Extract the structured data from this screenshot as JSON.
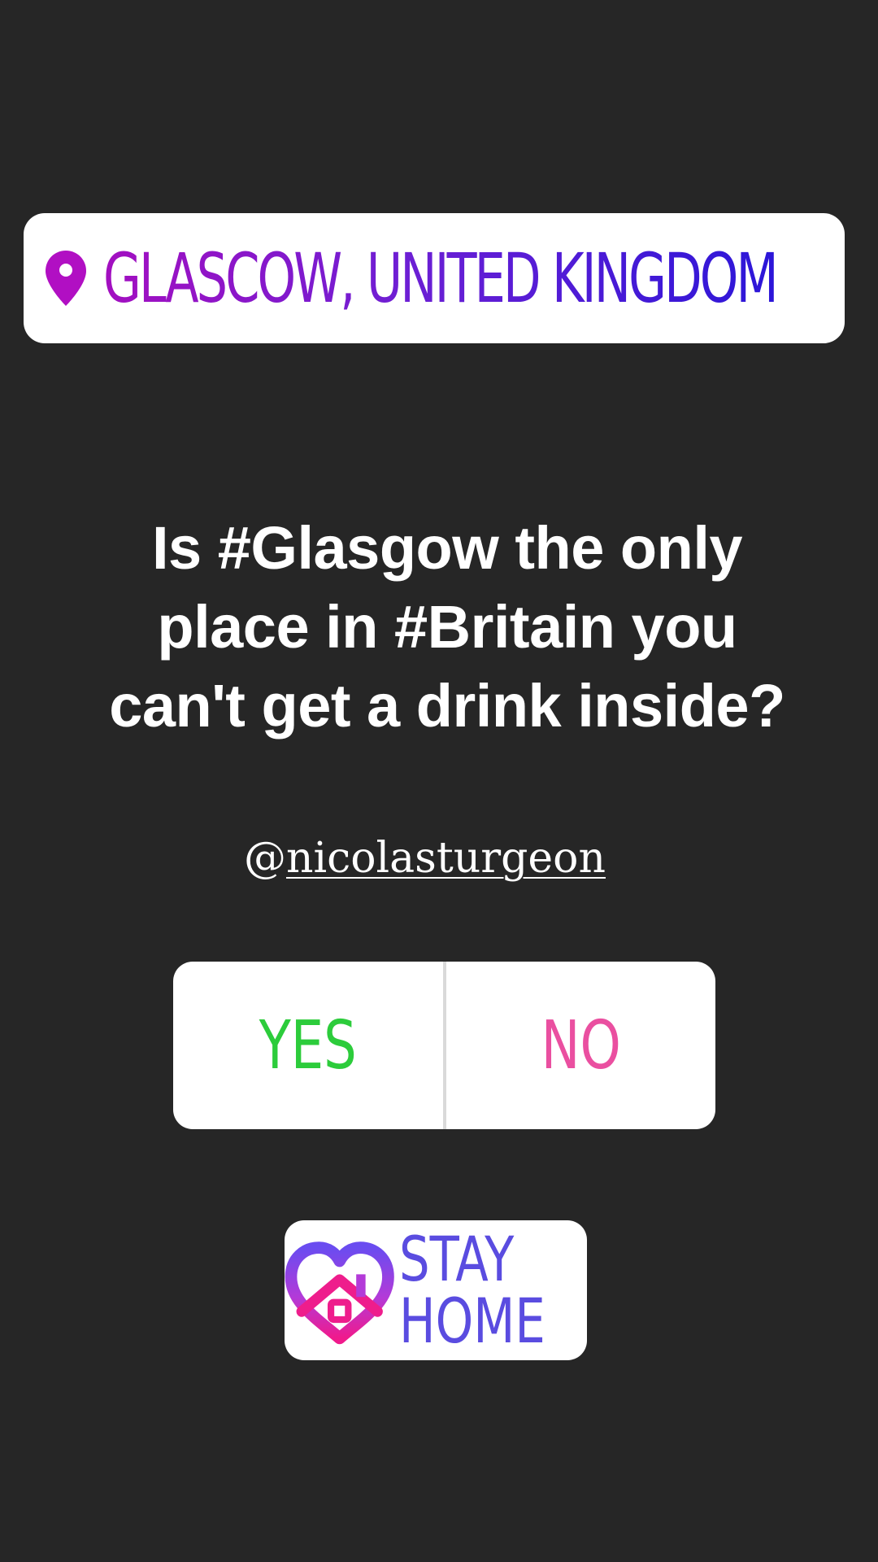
{
  "location": {
    "label": "GLASCOW, UNITED KINGDOM",
    "icon": "location-pin-icon",
    "gradient": [
      "#a30fc0",
      "#2b16d8"
    ]
  },
  "question": "Is #Glasgow the only\nplace in #Britain you\ncan't get a drink inside?",
  "mention": {
    "at": "@",
    "handle": "nicolasturgeon"
  },
  "poll": {
    "yes_label": "YES",
    "no_label": "NO",
    "yes_color": "#2ccc3b",
    "no_color": "#ea4fa0"
  },
  "stay_home": {
    "line1": "STAY",
    "line2": "HOME",
    "icon": "heart-house-icon"
  }
}
